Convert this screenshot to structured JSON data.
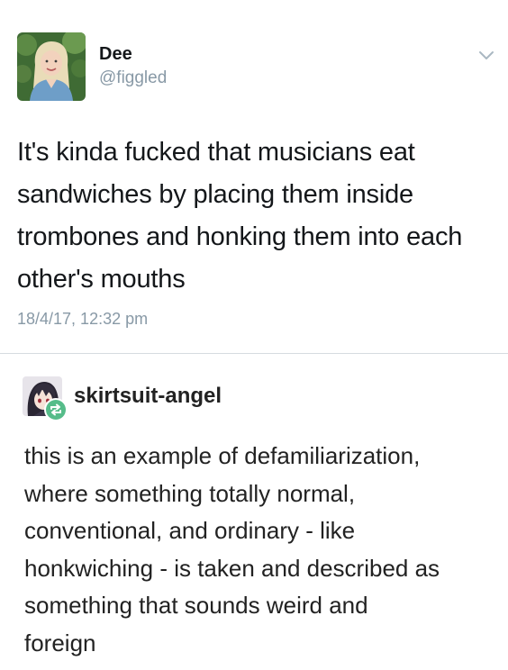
{
  "tweet": {
    "display_name": "Dee",
    "handle": "@figgled",
    "text_lines": [
      "It's kinda fucked that musicians eat",
      "sandwiches by placing them inside",
      "trombones and honking them into each",
      "other's mouths"
    ],
    "timestamp": "18/4/17, 12:32 pm",
    "avatar_icon": "profile-photo",
    "menu_icon": "chevron-down-icon"
  },
  "reblog": {
    "blog_name": "skirtsuit-angel",
    "avatar_icon": "anime-avatar",
    "badge_icon": "reblog-icon",
    "badge_color": "#56bc8a",
    "text_lines": [
      "this is an example of defamiliarization,",
      "where something totally normal,",
      "conventional, and ordinary - like",
      "honkwiching - is taken and described as",
      "something that sounds weird and",
      "foreign"
    ]
  },
  "colors": {
    "primary_text": "#14171a",
    "secondary_text": "#8899a6",
    "divider": "#d6dbe0",
    "tumblr_text": "#222222"
  }
}
